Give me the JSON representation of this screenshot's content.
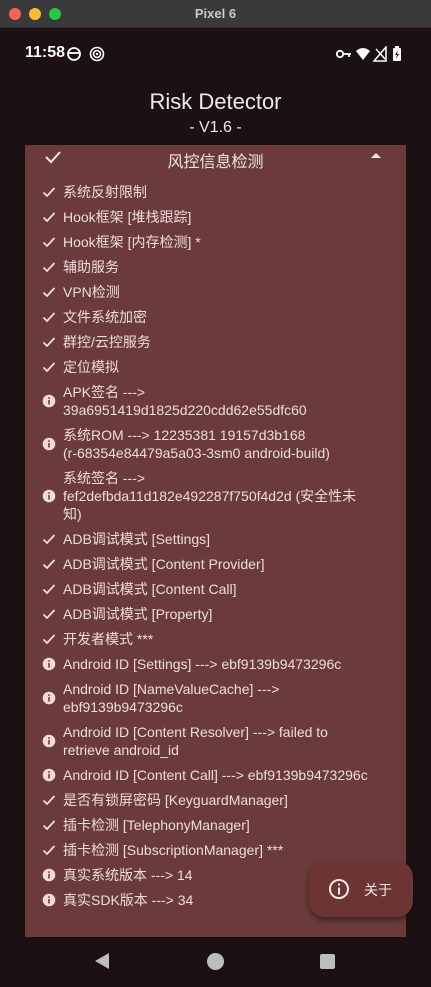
{
  "window": {
    "title": "Pixel 6"
  },
  "status_bar": {
    "time": "11:58"
  },
  "app": {
    "title": "Risk Detector",
    "version": "- V1.6 -"
  },
  "card": {
    "title": "风控信息检测",
    "items": [
      {
        "icon": "check-icon",
        "text": "系统反射限制"
      },
      {
        "icon": "check-icon",
        "text": "Hook框架 [堆栈跟踪]"
      },
      {
        "icon": "check-icon",
        "text": "Hook框架 [内存检测] *"
      },
      {
        "icon": "check-icon",
        "text": "辅助服务"
      },
      {
        "icon": "check-icon",
        "text": "VPN检测"
      },
      {
        "icon": "check-icon",
        "text": "文件系统加密"
      },
      {
        "icon": "check-icon",
        "text": "群控/云控服务"
      },
      {
        "icon": "check-icon",
        "text": "定位模拟"
      },
      {
        "icon": "info-icon",
        "text": "APK签名 --->\n39a6951419d1825d220cdd62e55dfc60"
      },
      {
        "icon": "info-icon",
        "text": "系统ROM ---> 12235381 19157d3b168\n(r-68354e84479a5a03-3sm0 android-build)"
      },
      {
        "icon": "info-icon",
        "text": "系统签名 --->\nfef2defbda11d182e492287f750f4d2d (安全性未\n知)"
      },
      {
        "icon": "check-icon",
        "text": "ADB调试模式 [Settings]"
      },
      {
        "icon": "check-icon",
        "text": "ADB调试模式 [Content Provider]"
      },
      {
        "icon": "check-icon",
        "text": "ADB调试模式 [Content Call]"
      },
      {
        "icon": "check-icon",
        "text": "ADB调试模式 [Property]"
      },
      {
        "icon": "check-icon",
        "text": "开发者模式 ***"
      },
      {
        "icon": "info-icon",
        "text": "Android ID [Settings] ---> ebf9139b9473296c"
      },
      {
        "icon": "info-icon",
        "text": "Android ID [NameValueCache] --->\nebf9139b9473296c"
      },
      {
        "icon": "info-icon",
        "text": "Android ID [Content Resolver] ---> failed to\nretrieve android_id"
      },
      {
        "icon": "info-icon",
        "text": "Android ID [Content Call] ---> ebf9139b9473296c"
      },
      {
        "icon": "check-icon",
        "text": "是否有锁屏密码 [KeyguardManager]"
      },
      {
        "icon": "check-icon",
        "text": "插卡检测 [TelephonyManager]"
      },
      {
        "icon": "check-icon",
        "text": "插卡检测 [SubscriptionManager] ***"
      },
      {
        "icon": "info-icon",
        "text": "真实系统版本 ---> 14"
      },
      {
        "icon": "info-icon",
        "text": "真实SDK版本 ---> 34"
      }
    ]
  },
  "fab": {
    "label": "关于",
    "icon": "info-outline-icon"
  },
  "colors": {
    "background": "#1c1112",
    "card": "#6b3b3b",
    "fab": "#6d3434",
    "text": "#eddcdc"
  }
}
